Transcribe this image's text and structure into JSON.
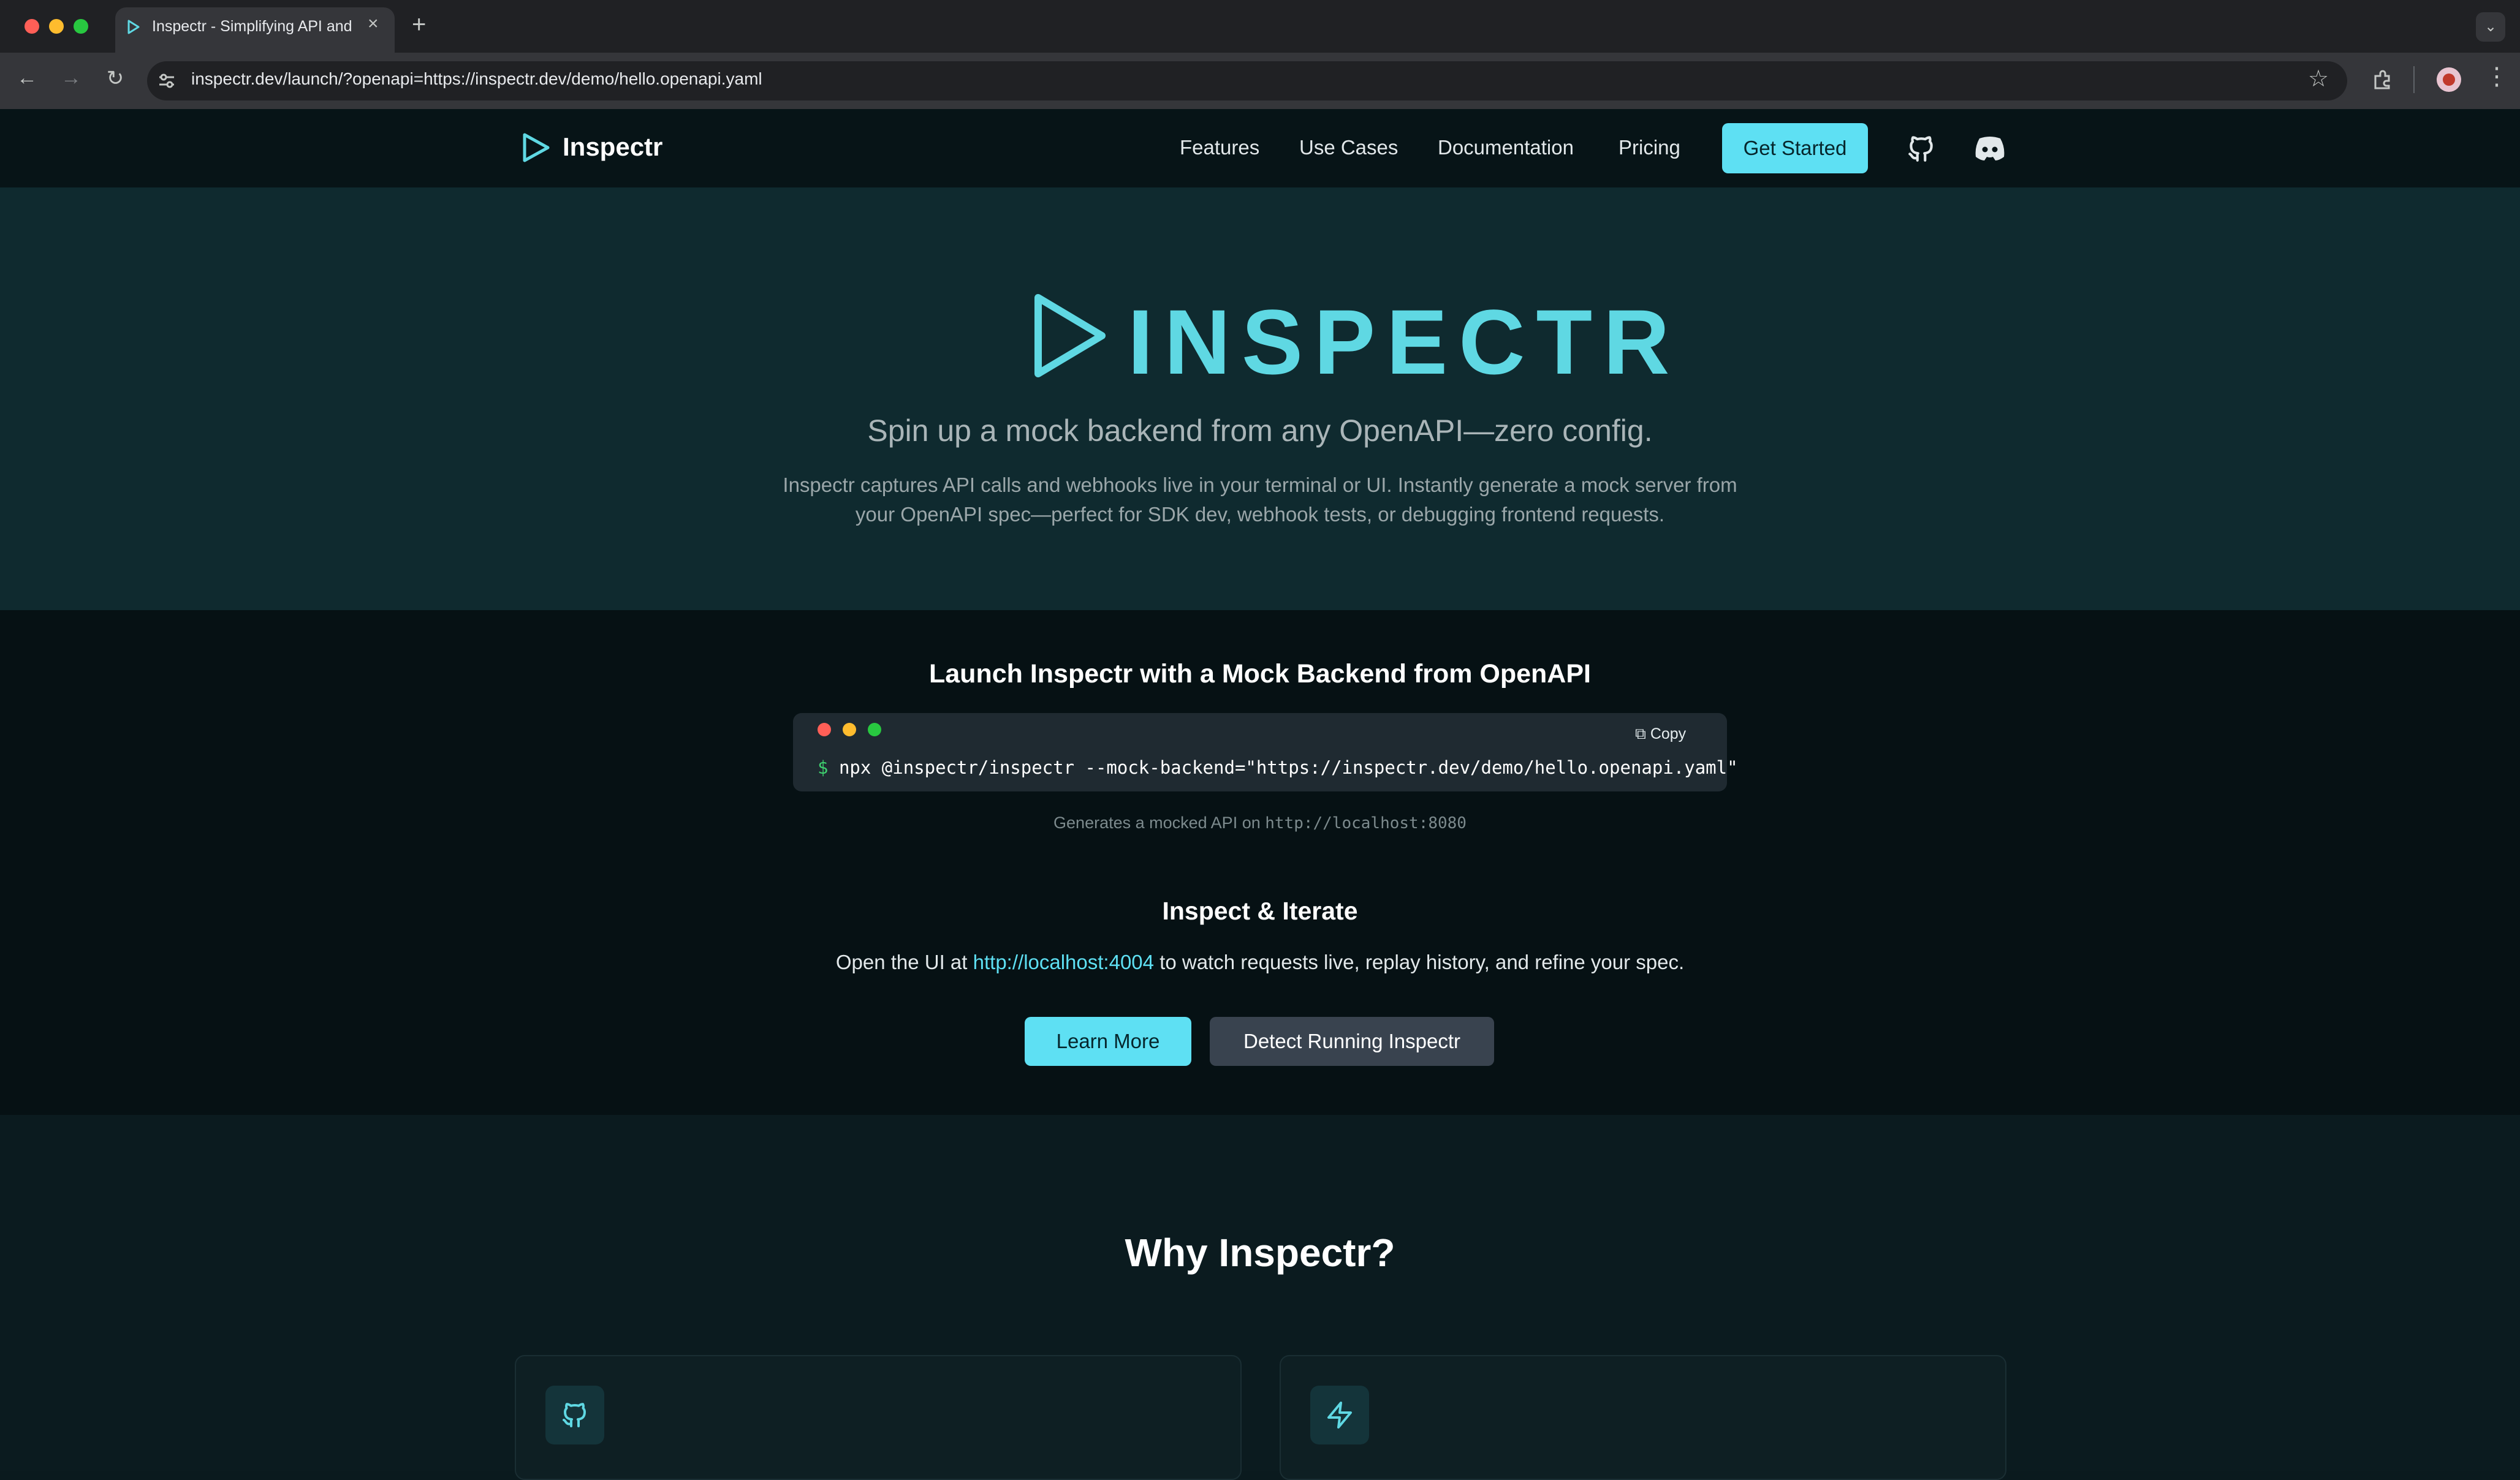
{
  "browser": {
    "tab_title": "Inspectr - Simplifying API and Webhook Debugging",
    "url": "inspectr.dev/launch/?openapi=https://inspectr.dev/demo/hello.openapi.yaml",
    "new_tab": "+",
    "close": "×"
  },
  "nav": {
    "brand": "Inspectr",
    "links": [
      "Features",
      "Use Cases",
      "Documentation",
      "Pricing"
    ],
    "cta": "Get Started"
  },
  "hero": {
    "logo_text": "INSPECTR",
    "tagline": "Spin up a mock backend from any OpenAPI—zero config.",
    "description": "Inspectr captures API calls and webhooks live in your terminal or UI. Instantly generate a mock server from your OpenAPI spec—perfect for SDK dev, webhook tests, or debugging frontend requests."
  },
  "launch": {
    "title": "Launch Inspectr with a Mock Backend from OpenAPI",
    "copy_label": "Copy",
    "prompt": "$",
    "command": "npx @inspectr/inspectr --mock-backend=\"https://inspectr.dev/demo/hello.openapi.yaml\"",
    "note_prefix": "Generates a mocked API on ",
    "note_url": "http://localhost:8080"
  },
  "inspect": {
    "title": "Inspect & Iterate",
    "desc_prefix": "Open the UI at ",
    "link": "http://localhost:4004",
    "desc_suffix": " to watch requests live, replay history, and refine your spec.",
    "learn_more": "Learn More",
    "detect": "Detect Running Inspectr"
  },
  "why": {
    "title": "Why Inspectr?",
    "cards": [
      {
        "icon": "github-icon"
      },
      {
        "icon": "lightning-icon"
      }
    ]
  },
  "colors": {
    "accent": "#5ee0f3",
    "logo": "#5fd8e3",
    "hero_bg": "#0f2a2f",
    "launch_bg": "#061114"
  }
}
